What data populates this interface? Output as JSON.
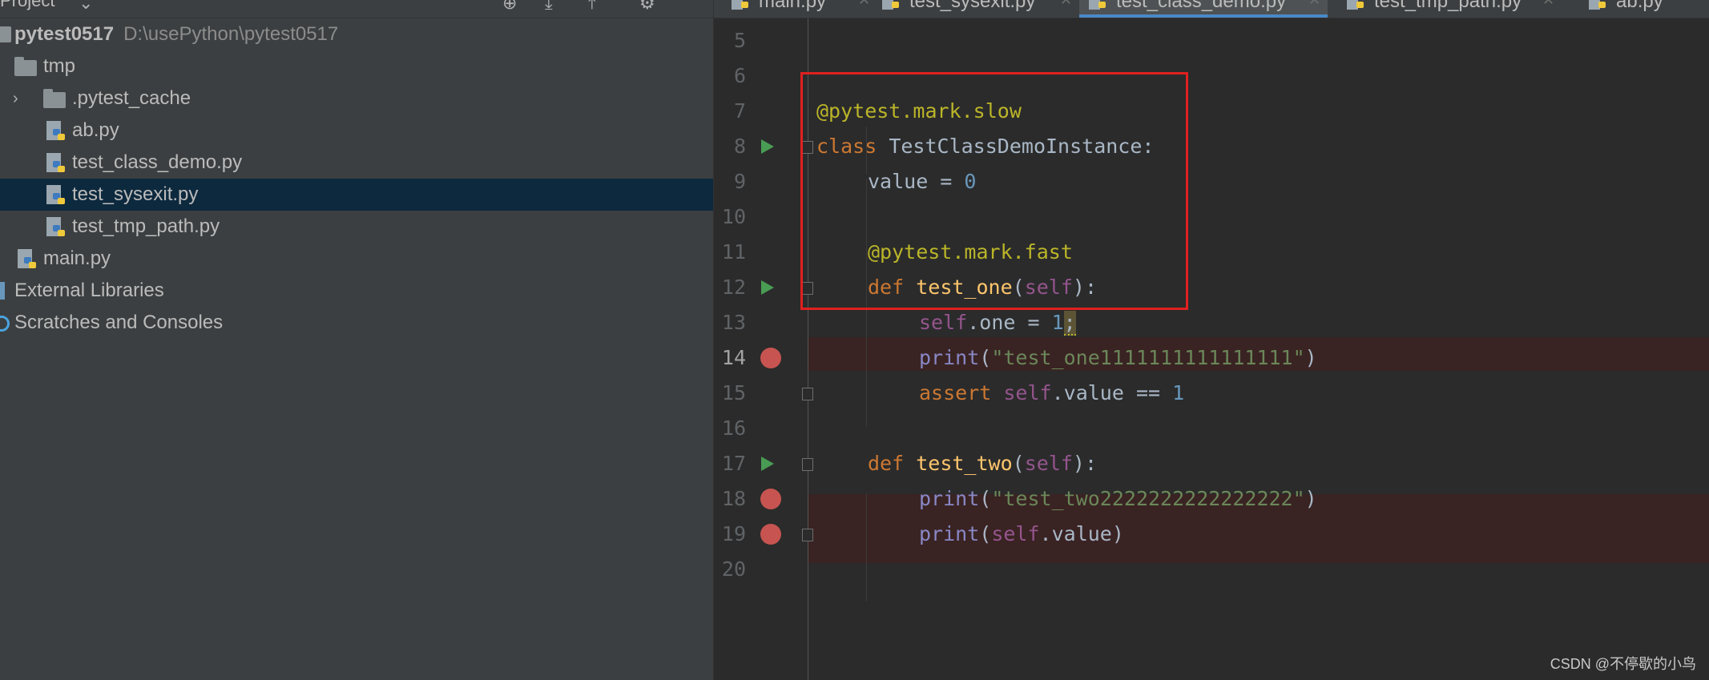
{
  "project_panel": {
    "title": "Project",
    "root": {
      "name": "pytest0517",
      "path": "D:\\usePython\\pytest0517"
    },
    "items": [
      {
        "label": "tmp",
        "type": "folder"
      },
      {
        "label": ".pytest_cache",
        "type": "folder"
      },
      {
        "label": "ab.py",
        "type": "python-file"
      },
      {
        "label": "test_class_demo.py",
        "type": "python-file"
      },
      {
        "label": "test_sysexit.py",
        "type": "python-file",
        "selected": true
      },
      {
        "label": "test_tmp_path.py",
        "type": "python-file"
      },
      {
        "label": "main.py",
        "type": "python-file"
      },
      {
        "label": "External Libraries",
        "type": "library"
      },
      {
        "label": "Scratches and Consoles",
        "type": "scratch"
      }
    ]
  },
  "tabs": [
    {
      "label": "main.py"
    },
    {
      "label": "test_sysexit.py"
    },
    {
      "label": "test_class_demo.py",
      "active": true
    },
    {
      "label": "test_tmp_path.py"
    },
    {
      "label": "ab.py"
    }
  ],
  "editor": {
    "lines": [
      {
        "n": "5"
      },
      {
        "n": "6"
      },
      {
        "n": "7"
      },
      {
        "n": "8"
      },
      {
        "n": "9"
      },
      {
        "n": "10"
      },
      {
        "n": "11"
      },
      {
        "n": "12"
      },
      {
        "n": "13"
      },
      {
        "n": "14"
      },
      {
        "n": "15"
      },
      {
        "n": "16"
      },
      {
        "n": "17"
      },
      {
        "n": "18"
      },
      {
        "n": "19"
      },
      {
        "n": "20"
      }
    ],
    "current_line": "14",
    "breakpoint_lines": [
      "14",
      "18",
      "19"
    ],
    "run_lines": [
      "8",
      "12",
      "17"
    ],
    "tokens": {
      "l7_dec": "@pytest.mark.slow",
      "l8_kw": "class",
      "l8_name": "TestClassDemoInstance",
      "l8_colon": ":",
      "l9_var": "value = ",
      "l9_num": "0",
      "l11_dec": "@pytest.mark.fast",
      "l12_kw": "def",
      "l12_fn": "test_one",
      "l12_p1": "(",
      "l12_self": "self",
      "l12_p2": "):",
      "l13_self": "self",
      "l13_rest": ".one = ",
      "l13_num": "1",
      "l13_semi": ";",
      "l14_fn": "print",
      "l14_p1": "(",
      "l14_str": "\"test_one1111111111111111\"",
      "l14_p2": ")",
      "l15_kw": "assert",
      "l15_self": "self",
      "l15_rest": ".value == ",
      "l15_num": "1",
      "l17_kw": "def",
      "l17_fn": "test_two",
      "l17_p1": "(",
      "l17_self": "self",
      "l17_p2": "):",
      "l18_fn": "print",
      "l18_p1": "(",
      "l18_str": "\"test_two2222222222222222\"",
      "l18_p2": ")",
      "l19_fn": "print",
      "l19_p1": "(",
      "l19_self": "self",
      "l19_rest": ".value)"
    }
  },
  "watermark": "CSDN @不停歇的小鸟",
  "colors": {
    "selection": "#0d293e",
    "breakpoint_line": "#3a2323",
    "breakpoint": "#c75450",
    "run_gutter": "#499c54",
    "annotation_box": "#e02020"
  }
}
